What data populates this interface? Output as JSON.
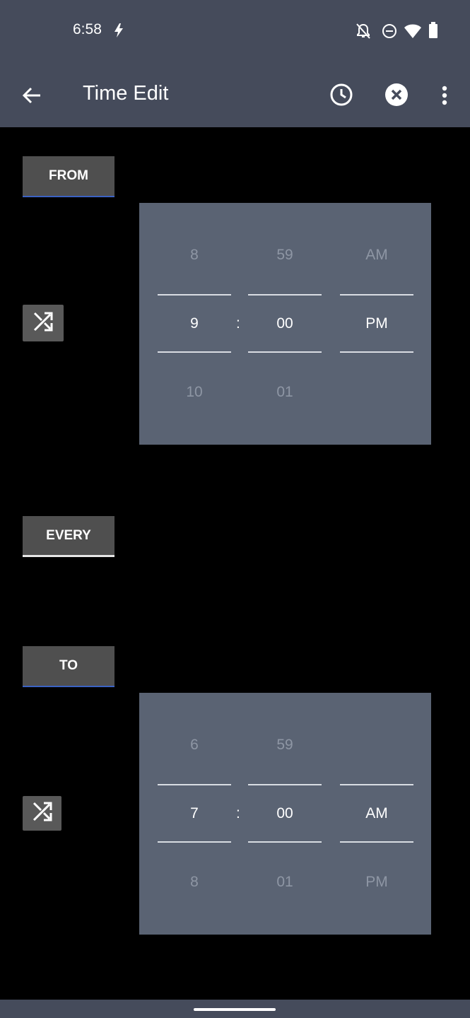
{
  "status_bar": {
    "time": "6:58",
    "icons": [
      "bolt-icon",
      "notifications-off-icon",
      "do-not-disturb-icon",
      "wifi-icon",
      "battery-icon"
    ]
  },
  "app_bar": {
    "title": "Time Edit",
    "actions": [
      "back-arrow-icon",
      "clock-icon",
      "close-circle-icon",
      "more-vert-icon"
    ]
  },
  "sections": {
    "from": {
      "label": "FROM",
      "picker": {
        "hour": {
          "above": "8",
          "selected": "9",
          "below": "10"
        },
        "minute": {
          "above": "59",
          "selected": "00",
          "below": "01"
        },
        "ampm": {
          "above": "AM",
          "selected": "PM",
          "below": ""
        },
        "separator": ":"
      }
    },
    "every": {
      "label": "EVERY"
    },
    "to": {
      "label": "TO",
      "picker": {
        "hour": {
          "above": "6",
          "selected": "7",
          "below": "8"
        },
        "minute": {
          "above": "59",
          "selected": "00",
          "below": "01"
        },
        "ampm": {
          "above": "",
          "selected": "AM",
          "below": "PM"
        },
        "separator": ":"
      }
    }
  },
  "colors": {
    "app_bar": "#454b5b",
    "picker_bg": "#5a6373",
    "button_bg": "#4f4f4f",
    "tab_underline_blue": "#3b62c4",
    "background": "#000000"
  }
}
